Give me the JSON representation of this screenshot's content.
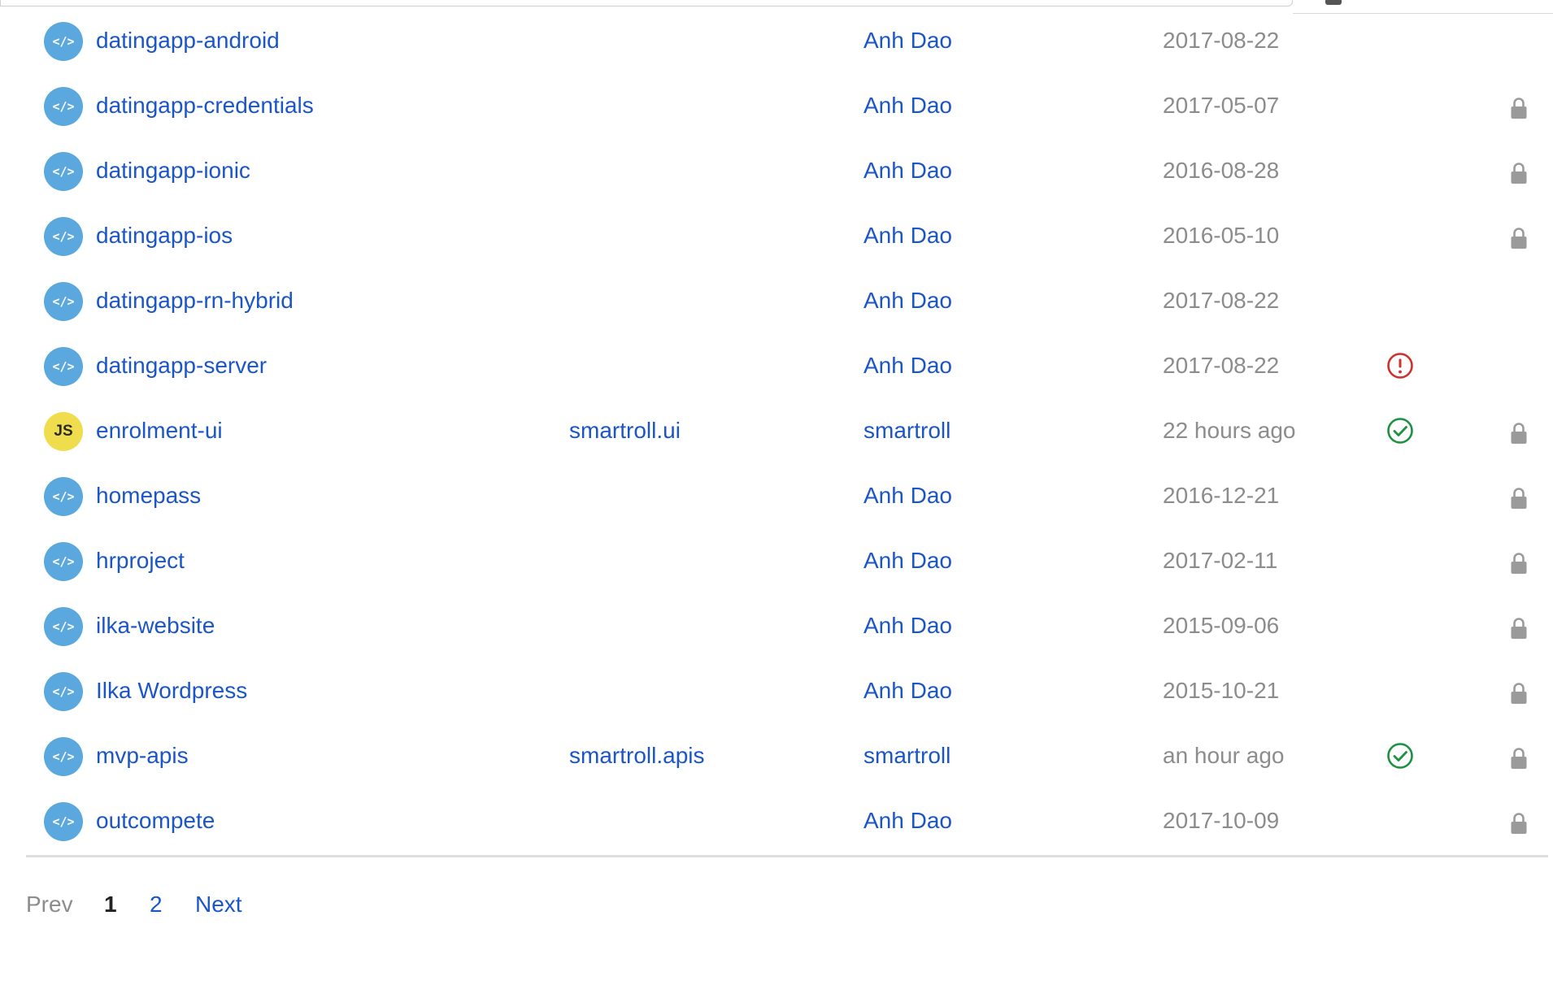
{
  "colors": {
    "link": "#1a56c7",
    "muted": "#8c8c8c",
    "project_avatar": "#5aa8dd",
    "js_avatar": "#f0dd4d",
    "success": "#1e9141",
    "error": "#d0302c",
    "lock": "#9a9a9a"
  },
  "projects": [
    {
      "avatar": "code-icon",
      "name": "datingapp-android",
      "namespace": "",
      "owner": "Anh Dao",
      "date": "2017-08-22",
      "status": "",
      "locked": false
    },
    {
      "avatar": "code-icon",
      "name": "datingapp-credentials",
      "namespace": "",
      "owner": "Anh Dao",
      "date": "2017-05-07",
      "status": "",
      "locked": true
    },
    {
      "avatar": "code-icon",
      "name": "datingapp-ionic",
      "namespace": "",
      "owner": "Anh Dao",
      "date": "2016-08-28",
      "status": "",
      "locked": true
    },
    {
      "avatar": "code-icon",
      "name": "datingapp-ios",
      "namespace": "",
      "owner": "Anh Dao",
      "date": "2016-05-10",
      "status": "",
      "locked": true
    },
    {
      "avatar": "code-icon",
      "name": "datingapp-rn-hybrid",
      "namespace": "",
      "owner": "Anh Dao",
      "date": "2017-08-22",
      "status": "",
      "locked": false
    },
    {
      "avatar": "code-icon",
      "name": "datingapp-server",
      "namespace": "",
      "owner": "Anh Dao",
      "date": "2017-08-22",
      "status": "error",
      "locked": false
    },
    {
      "avatar": "js-badge",
      "avatar_text": "JS",
      "name": "enrolment-ui",
      "namespace": "smartroll.ui",
      "owner": "smartroll",
      "date": "22 hours ago",
      "status": "success",
      "locked": true
    },
    {
      "avatar": "code-icon",
      "name": "homepass",
      "namespace": "",
      "owner": "Anh Dao",
      "date": "2016-12-21",
      "status": "",
      "locked": true
    },
    {
      "avatar": "code-icon",
      "name": "hrproject",
      "namespace": "",
      "owner": "Anh Dao",
      "date": "2017-02-11",
      "status": "",
      "locked": true
    },
    {
      "avatar": "code-icon",
      "name": "ilka-website",
      "namespace": "",
      "owner": "Anh Dao",
      "date": "2015-09-06",
      "status": "",
      "locked": true
    },
    {
      "avatar": "code-icon",
      "name": "Ilka Wordpress",
      "namespace": "",
      "owner": "Anh Dao",
      "date": "2015-10-21",
      "status": "",
      "locked": true
    },
    {
      "avatar": "code-icon",
      "name": "mvp-apis",
      "namespace": "smartroll.apis",
      "owner": "smartroll",
      "date": "an hour ago",
      "status": "success",
      "locked": true
    },
    {
      "avatar": "code-icon",
      "name": "outcompete",
      "namespace": "",
      "owner": "Anh Dao",
      "date": "2017-10-09",
      "status": "",
      "locked": true
    }
  ],
  "pagination": {
    "prev_label": "Prev",
    "current_page": "1",
    "next_page": "2",
    "next_label": "Next"
  }
}
